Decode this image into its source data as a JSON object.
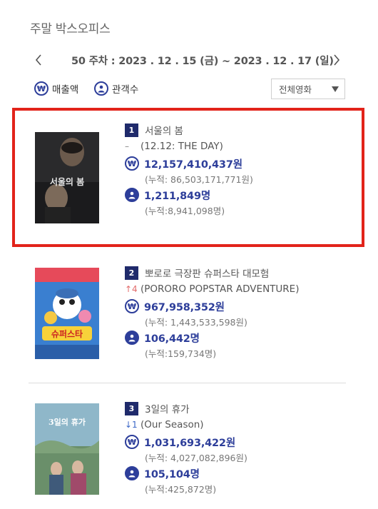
{
  "header": {
    "title": "주말 박스오피스"
  },
  "week": {
    "text": "50 주차 : 2023 . 12 . 15 (금) ~ 2023 . 12 . 17 (일)"
  },
  "filters": {
    "sales_label": "매출액",
    "audience_label": "관객수",
    "sales_icon": "₩"
  },
  "select": {
    "value": "전체영화"
  },
  "colors": {
    "accent": "#2d3e9a",
    "rank_bg": "#1f2a6b",
    "highlight": "#e2231a",
    "up": "#e26a6a",
    "down": "#3a66c7"
  },
  "movies": [
    {
      "rank": "1",
      "title": "서울의 봄",
      "delta": "–",
      "eng_title": "(12.12: THE DAY)",
      "sales": "12,157,410,437원",
      "sales_cum": "(누적: 86,503,171,771원)",
      "audience": "1,211,849명",
      "audience_cum": "(누적:8,941,098명)",
      "poster_text": "서울의 봄"
    },
    {
      "rank": "2",
      "title": "뽀로로 극장판 슈퍼스타 대모험",
      "delta": "↑4",
      "eng_title": "(PORORO POPSTAR ADVENTURE)",
      "sales": "967,958,352원",
      "sales_cum": "(누적: 1,443,533,598원)",
      "audience": "106,442명",
      "audience_cum": "(누적:159,734명)",
      "poster_text": "슈퍼스타"
    },
    {
      "rank": "3",
      "title": "3일의 휴가",
      "delta": "↓1",
      "eng_title": "(Our Season)",
      "sales": "1,031,693,422원",
      "sales_cum": "(누적: 4,027,082,896원)",
      "audience": "105,104명",
      "audience_cum": "(누적:425,872명)",
      "poster_text": "3일의 휴가"
    }
  ]
}
